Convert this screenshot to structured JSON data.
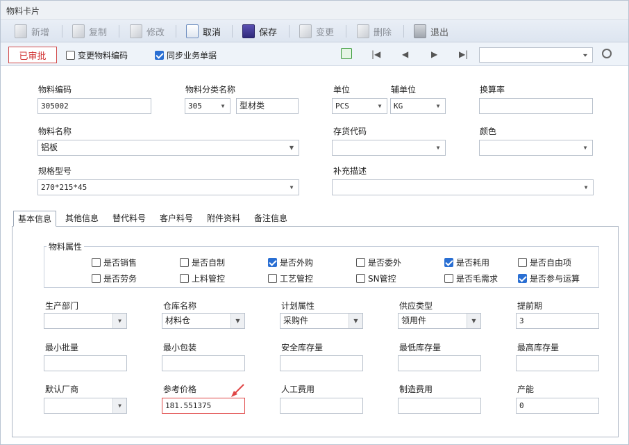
{
  "window": {
    "title": "物料卡片"
  },
  "toolbar": {
    "new": "新增",
    "copy": "复制",
    "modify": "修改",
    "cancel": "取消",
    "save": "保存",
    "change": "变更",
    "delete": "删除",
    "exit": "退出"
  },
  "status": {
    "approved": "已审批",
    "change_code": "变更物料编码",
    "change_code_checked": false,
    "sync_docs": "同步业务单据",
    "sync_docs_checked": true,
    "nav_select_value": ""
  },
  "header": {
    "code_label": "物料编码",
    "code_value": "305002",
    "category_label": "物料分类名称",
    "category_code": "305",
    "category_name": "型材类",
    "unit_label": "单位",
    "unit_value": "PCS",
    "aux_unit_label": "辅单位",
    "aux_unit_value": "KG",
    "ratio_label": "换算率",
    "ratio_value": "",
    "name_label": "物料名称",
    "name_value": "铝板",
    "stock_code_label": "存货代码",
    "stock_code_value": "",
    "color_label": "颜色",
    "color_value": "",
    "spec_label": "规格型号",
    "spec_value": "270*215*45",
    "extra_desc_label": "补充描述",
    "extra_desc_value": ""
  },
  "tabs": [
    "基本信息",
    "其他信息",
    "替代料号",
    "客户料号",
    "附件资料",
    "备注信息"
  ],
  "attributes": {
    "title": "物料属性",
    "items": [
      {
        "label": "是否销售",
        "checked": false
      },
      {
        "label": "是否自制",
        "checked": false
      },
      {
        "label": "是否外购",
        "checked": true
      },
      {
        "label": "是否委外",
        "checked": false
      },
      {
        "label": "是否耗用",
        "checked": true
      },
      {
        "label": "是否自由项",
        "checked": false
      },
      {
        "label": "是否劳务",
        "checked": false
      },
      {
        "label": "上料管控",
        "checked": false
      },
      {
        "label": "工艺管控",
        "checked": false
      },
      {
        "label": "SN管控",
        "checked": false
      },
      {
        "label": "是否毛需求",
        "checked": false
      },
      {
        "label": "是否参与运算",
        "checked": true
      }
    ]
  },
  "basic": {
    "dept_label": "生产部门",
    "dept_value": "",
    "warehouse_label": "仓库名称",
    "warehouse_value": "材料仓",
    "plan_label": "计划属性",
    "plan_value": "采购件",
    "supply_label": "供应类型",
    "supply_value": "领用件",
    "lead_label": "提前期",
    "lead_value": "3",
    "min_batch_label": "最小批量",
    "min_batch_value": "",
    "min_pack_label": "最小包装",
    "min_pack_value": "",
    "safety_label": "安全库存量",
    "safety_value": "",
    "min_stock_label": "最低库存量",
    "min_stock_value": "",
    "max_stock_label": "最高库存量",
    "max_stock_value": "",
    "vendor_label": "默认厂商",
    "vendor_value": "",
    "ref_price_label": "参考价格",
    "ref_price_value": "181.551375",
    "labor_label": "人工费用",
    "labor_value": "",
    "mfg_label": "制造费用",
    "mfg_value": "",
    "capacity_label": "产能",
    "capacity_value": "0"
  },
  "colors": {
    "accent": "#2a6fd3",
    "approved_red": "#d03030",
    "highlight_red": "#e04545"
  }
}
